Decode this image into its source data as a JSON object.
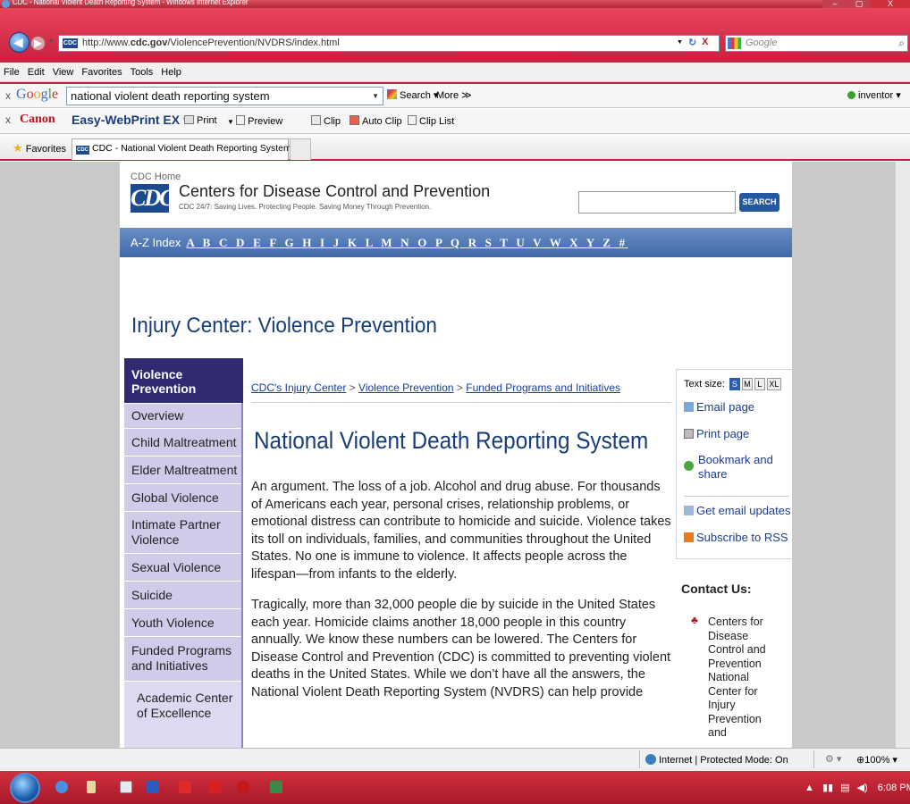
{
  "window": {
    "title": "CDC - National Violent Death Reporting System - Windows Internet Explorer",
    "controls": [
      "–",
      "▢",
      "X"
    ]
  },
  "address": {
    "url": "http://www.cdc.gov/ViolencePrevention/NVDRS/index.html",
    "url_prefix": "http://www.",
    "url_domain": "cdc.gov",
    "url_path": "/ViolencePrevention/NVDRS/index.html",
    "search_placeholder": "Google",
    "refresh": "↻",
    "stop": "X",
    "fav_icon": "CDC"
  },
  "menu": [
    "File",
    "Edit",
    "View",
    "Favorites",
    "Tools",
    "Help"
  ],
  "google_toolbar": {
    "close": "x",
    "logo": "Google",
    "query": "national violent death reporting system",
    "search": "Search ▾",
    "more": "More ≫",
    "user": "inventor ▾"
  },
  "canon_toolbar": {
    "close": "x",
    "brand": "Canon",
    "product": "Easy-WebPrint EX ▾",
    "print": "Print",
    "preview": "Preview",
    "clip": "Clip",
    "auto_clip": "Auto Clip",
    "clip_list": "Clip List"
  },
  "favorites_bar": {
    "favorites": "Favorites",
    "tab_label": "CDC - National Violent Death Reporting System"
  },
  "site": {
    "home_link": "CDC Home",
    "logo": "CDC",
    "org_name": "Centers for Disease Control and Prevention",
    "tagline": "CDC 24/7: Saving Lives. Protecting People. Saving Money Through Prevention.",
    "search_button": "SEARCH",
    "az_label": "A-Z Index",
    "az_letters": "A B C D E F G H I J K L M N O P Q R S T U V W X Y Z #",
    "section_title": "Injury Center: Violence Prevention"
  },
  "leftnav": {
    "head": "Violence Prevention",
    "items": [
      "Overview",
      "Child Maltreatment",
      "Elder Maltreatment",
      "Global Violence",
      "Intimate Partner Violence",
      "Sexual Violence",
      "Suicide",
      "Youth Violence",
      "Funded Programs and Initiatives",
      "Academic Center of Excellence"
    ]
  },
  "breadcrumb": [
    "CDC's Injury Center",
    "Violence Prevention",
    "Funded Programs and Initiatives"
  ],
  "breadcrumb_sep": ">",
  "main": {
    "title": "National Violent Death Reporting System",
    "para1": "An argument. The loss of a job. Alcohol and drug abuse. For thousands of Americans each year, personal crises, relationship problems, or emotional distress can contribute to homicide and suicide. Violence takes its toll on individuals, families, and communities throughout the United States. No one is immune to violence. It affects people across the lifespan—from infants to the elderly.",
    "para2": "Tragically, more than 32,000 people die by suicide in the United States each year. Homicide claims another 18,000 people in this country annually.  We know these numbers can be lowered. The Centers for Disease Control and Prevention (CDC) is committed to preventing violent deaths in the United States.  While we don’t have all the answers, the National Violent Death Reporting System (NVDRS) can help provide"
  },
  "tools": {
    "text_size_label": "Text size:",
    "sizes": [
      "S",
      "M",
      "L",
      "XL"
    ],
    "email": "Email page",
    "print": "Print page",
    "bookmark": "Bookmark and share",
    "updates": "Get email updates",
    "rss": "Subscribe to RSS"
  },
  "contact": {
    "heading": "Contact Us:",
    "text": "Centers for Disease Control and Prevention National Center for Injury Prevention and"
  },
  "status": {
    "zone": "Internet | Protected Mode: On",
    "zoom": "100%"
  },
  "taskbar": {
    "time": "6:08 PM"
  }
}
